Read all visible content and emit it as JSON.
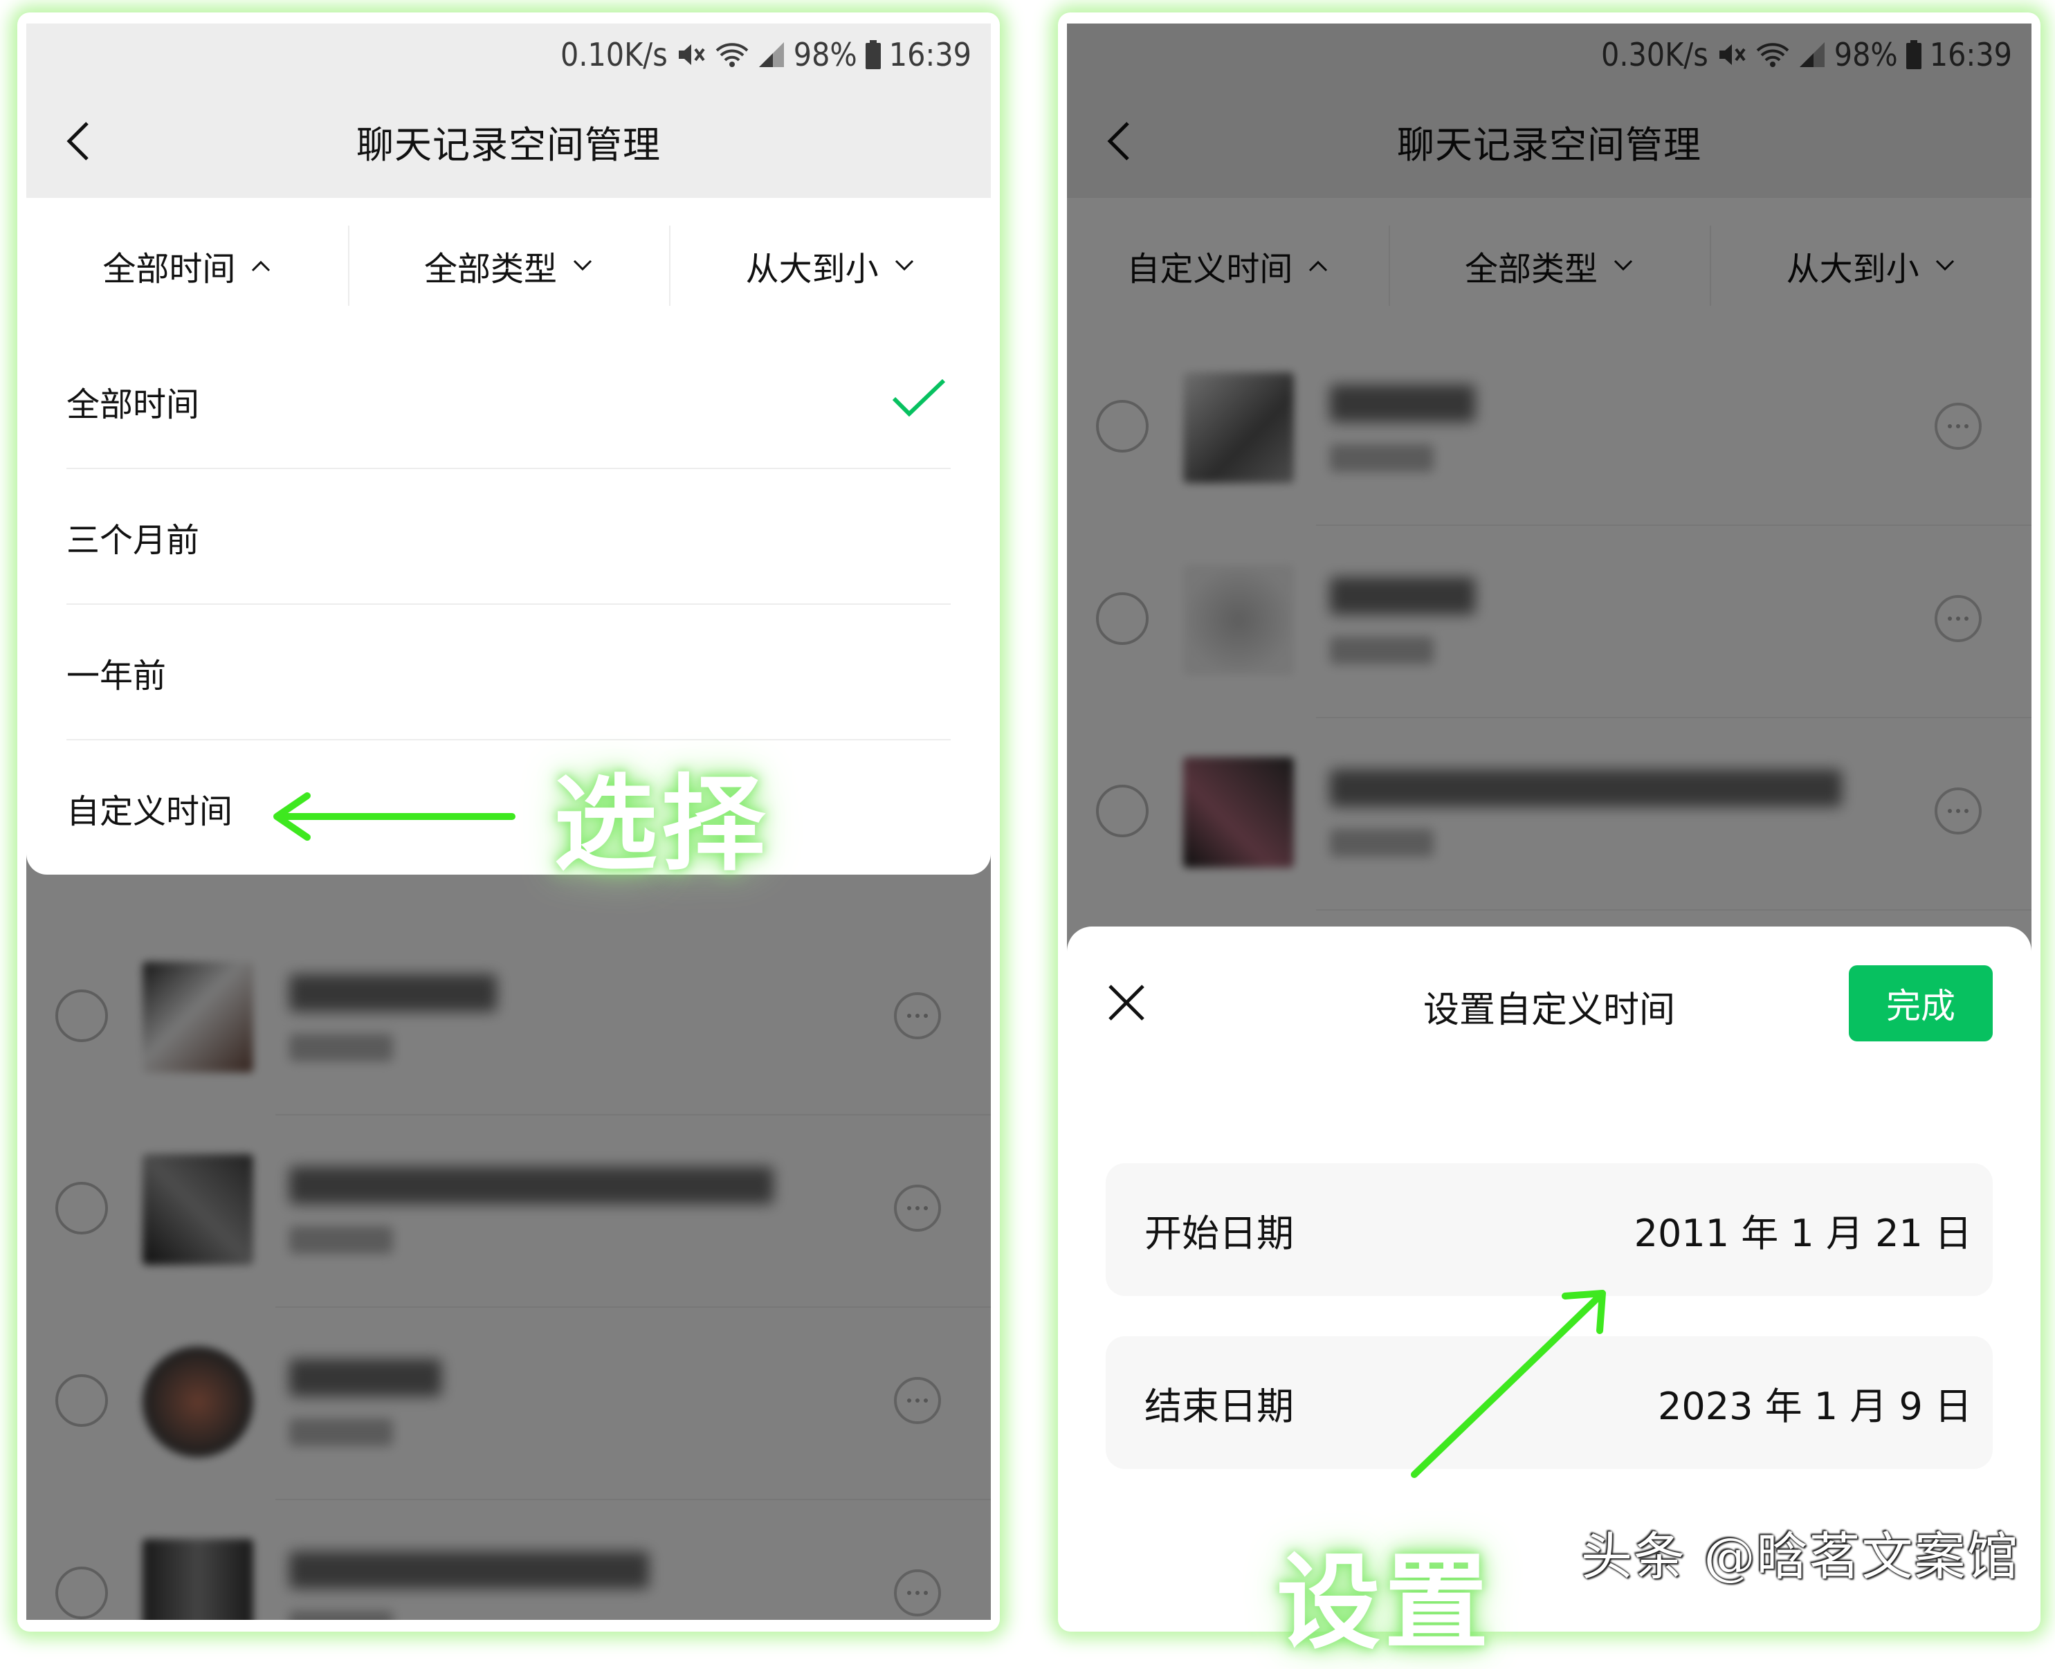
{
  "left_screen": {
    "status": {
      "speed": "0.10K/s",
      "battery": "98%",
      "time": "16:39"
    },
    "title": "聊天记录空间管理",
    "filters": [
      {
        "label": "全部时间",
        "chevron": "up"
      },
      {
        "label": "全部类型",
        "chevron": "down"
      },
      {
        "label": "从大到小",
        "chevron": "down"
      }
    ],
    "time_options": [
      {
        "label": "全部时间",
        "selected": true
      },
      {
        "label": "三个月前",
        "selected": false
      },
      {
        "label": "一年前",
        "selected": false
      },
      {
        "label": "自定义时间",
        "selected": false
      }
    ],
    "annotation": "选择"
  },
  "right_screen": {
    "status": {
      "speed": "0.30K/s",
      "battery": "98%",
      "time": "16:39"
    },
    "title": "聊天记录空间管理",
    "filters": [
      {
        "label": "自定义时间",
        "chevron": "up"
      },
      {
        "label": "全部类型",
        "chevron": "down"
      },
      {
        "label": "从大到小",
        "chevron": "down"
      }
    ],
    "sheet": {
      "title": "设置自定义时间",
      "done_label": "完成",
      "start_label": "开始日期",
      "start_value": "2011 年 1 月 21 日",
      "end_label": "结束日期",
      "end_value": "2023 年 1 月 9 日"
    },
    "annotation": "设置"
  },
  "watermark": "头条 @晗茗文案馆",
  "colors": {
    "accent_green": "#07c160",
    "annotation_green": "#3ee81f",
    "check_green": "#07c160"
  },
  "icons": [
    "back-arrow-icon",
    "chevron-up-icon",
    "chevron-down-icon",
    "checkmark-icon",
    "close-icon",
    "more-options-icon",
    "wifi-icon",
    "mute-icon",
    "signal-icon",
    "battery-icon"
  ]
}
